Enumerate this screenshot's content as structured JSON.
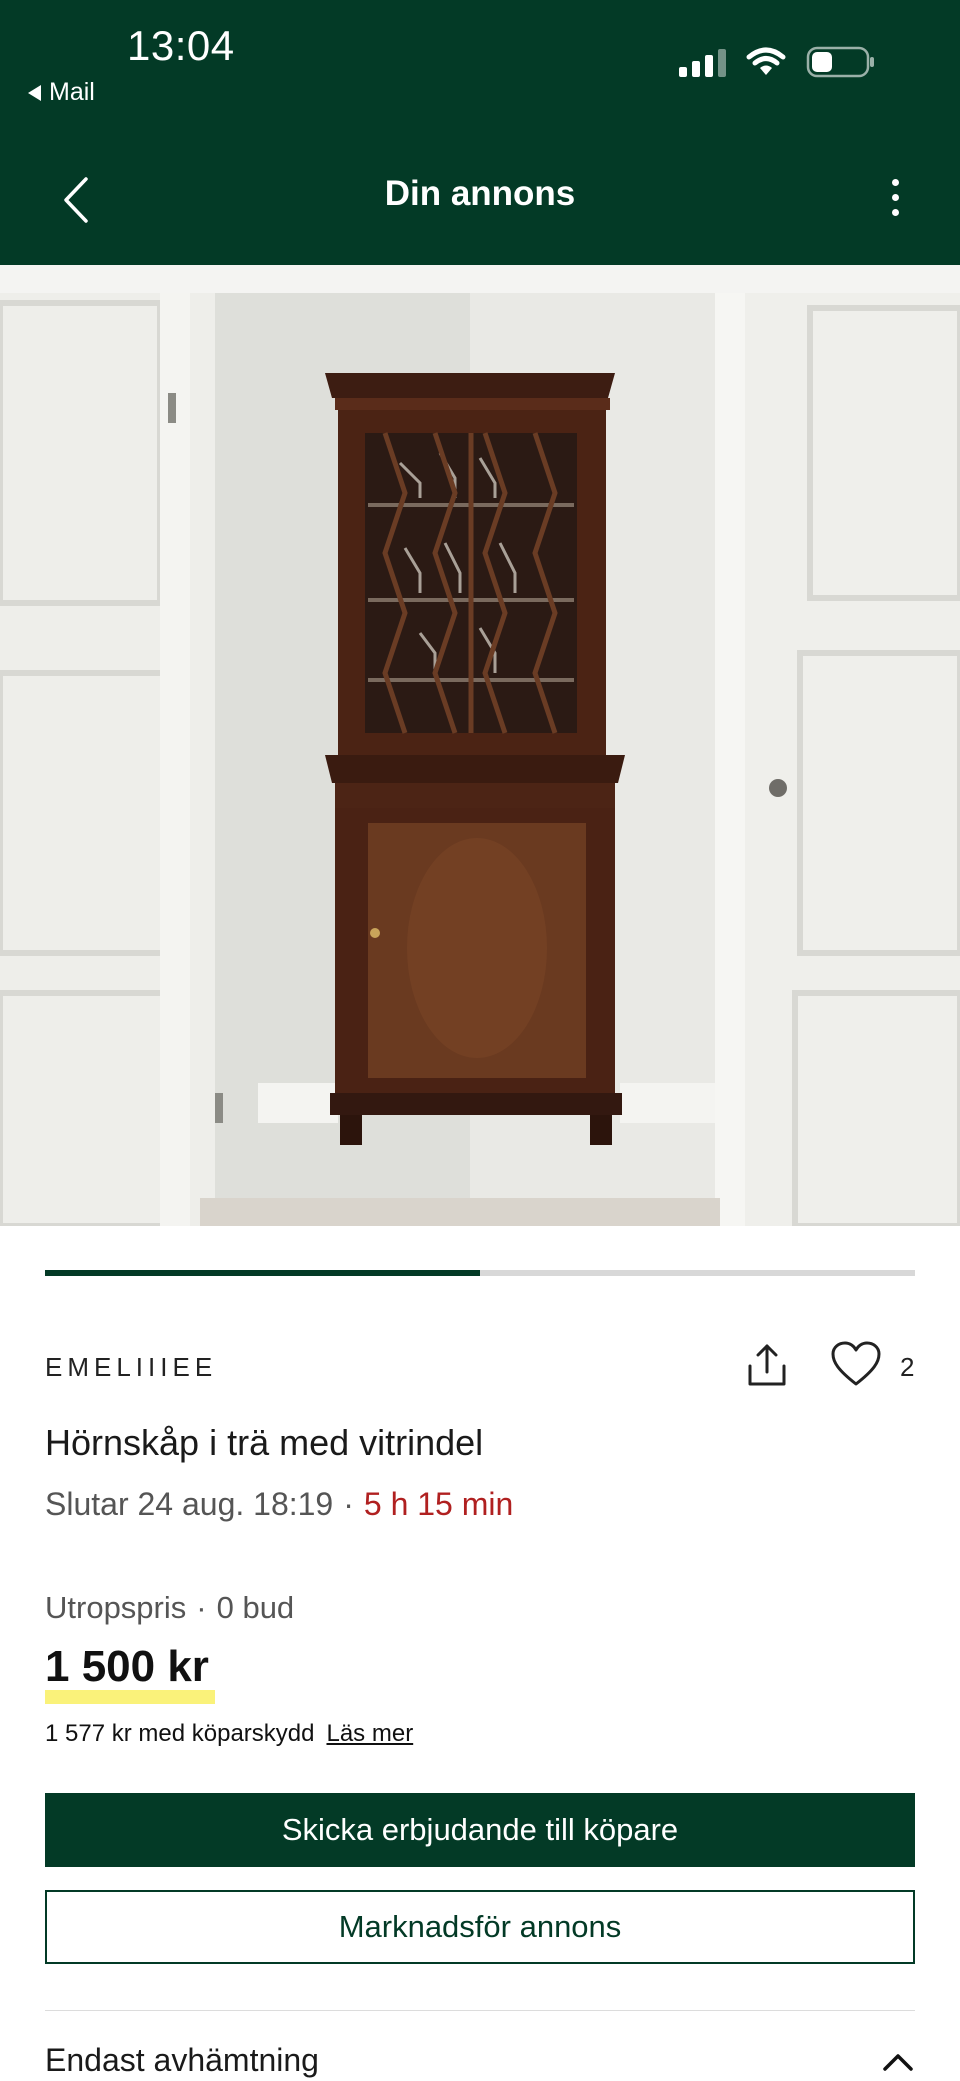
{
  "status_bar": {
    "time": "13:04",
    "back_app": "Mail"
  },
  "nav": {
    "title": "Din annons",
    "back_icon": "chevron-left-icon",
    "more_icon": "more-vertical-icon"
  },
  "gallery": {
    "progress_fraction": 0.5
  },
  "listing": {
    "seller": "EMELIIIEE",
    "favorites_count": "2",
    "title": "Hörnskåp i trä med vitrindel",
    "ends_label": "Slutar 24 aug. 18:19",
    "separator": "·",
    "time_remaining": "5 h 15 min"
  },
  "price": {
    "type_label": "Utropspris",
    "separator": "·",
    "bids": "0 bud",
    "amount": "1 500 kr",
    "protection_text": "1 577 kr med köparskydd",
    "read_more": "Läs mer"
  },
  "actions": {
    "primary": "Skicka erbjudande till köpare",
    "secondary": "Marknadsför annons"
  },
  "delivery": {
    "label": "Endast avhämtning"
  },
  "colors": {
    "brand_green": "#033a26",
    "countdown_red": "#b02020",
    "highlight_yellow": "#faf27a"
  }
}
